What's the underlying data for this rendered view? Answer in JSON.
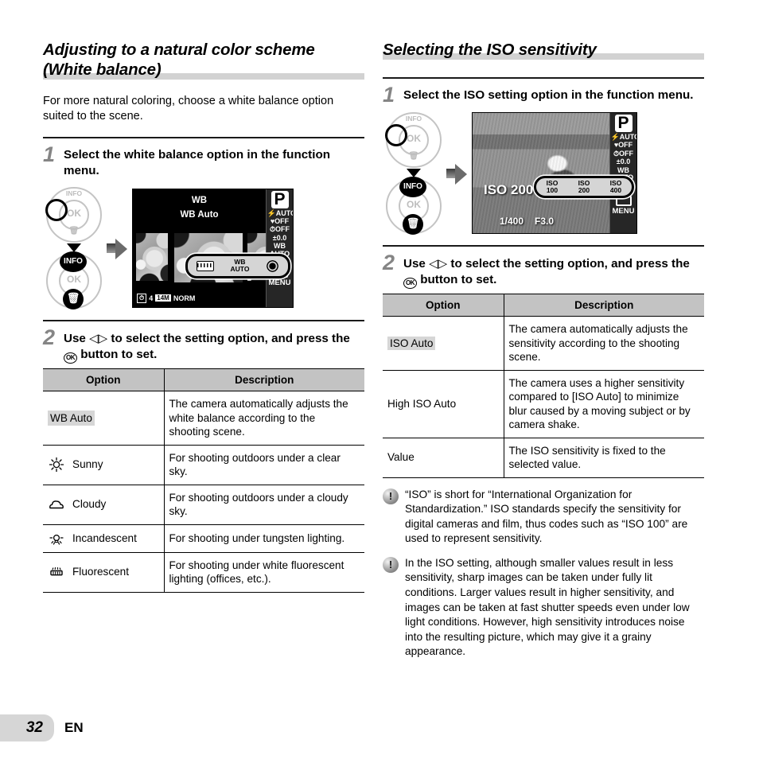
{
  "page": {
    "number": "32",
    "language": "EN"
  },
  "left_column": {
    "heading": "Adjusting to a natural color scheme (White balance)",
    "intro": "For more natural coloring, choose a white balance option suited to the scene.",
    "step1": {
      "number": "1",
      "text_before": "Select the white balance option in the function menu."
    },
    "step2": {
      "number": "2",
      "part1": "Use",
      "arrows": "◁▷",
      "part2": "to select the setting option, and press the",
      "ok_glyph": "OK",
      "part3": "button to set."
    },
    "illustration": {
      "dial_labels": {
        "info": "INFO",
        "ok": "OK",
        "trash": "Ὕ1"
      },
      "dial_top": {
        "info": "INFO",
        "ok": "OK"
      },
      "dial_bottom": {
        "info": "INFO",
        "ok": "OK"
      },
      "lcd": {
        "title": "WB",
        "subtitle": "WB Auto",
        "mode": "P",
        "menu_items": [
          "AUTO",
          "OFF",
          "OFF",
          "±0.0",
          "WB AUTO",
          "AUTO"
        ],
        "menu_label": "MENU",
        "selection_bar": {
          "label_line1": "WB",
          "label_line2": "AUTO"
        },
        "status": {
          "icon": "self-timer",
          "frames": "4",
          "size": "14M",
          "quality": "NORM"
        }
      }
    },
    "table": {
      "headers": [
        "Option",
        "Description"
      ],
      "rows": [
        {
          "icon": "none",
          "option": "WB Auto",
          "highlight": true,
          "description": "The camera automatically adjusts the white balance according to the shooting scene."
        },
        {
          "icon": "sun-icon",
          "option": "Sunny",
          "highlight": false,
          "description": "For shooting outdoors under a clear sky."
        },
        {
          "icon": "cloud-icon",
          "option": "Cloudy",
          "highlight": false,
          "description": "For shooting outdoors under a cloudy sky."
        },
        {
          "icon": "bulb-icon",
          "option": "Incandescent",
          "highlight": false,
          "description": "For shooting under tungsten lighting."
        },
        {
          "icon": "fluorescent-icon",
          "option": "Fluorescent",
          "highlight": false,
          "description": "For shooting under white fluorescent lighting (offices, etc.)."
        }
      ]
    }
  },
  "right_column": {
    "heading": "Selecting the ISO sensitivity",
    "step1": {
      "number": "1",
      "text_before": "Select the ISO setting option in the function menu."
    },
    "step2": {
      "number": "2",
      "part1": "Use",
      "arrows": "◁▷",
      "part2": "to select the setting option, and press the",
      "ok_glyph": "OK",
      "part3": "button to set."
    },
    "illustration": {
      "lcd": {
        "mode": "P",
        "menu_items": [
          "AUTO",
          "OFF",
          "OFF",
          "±0.0",
          "WB AUTO"
        ],
        "menu_label": "MENU",
        "iso_reading": "ISO 200",
        "shutter": "1/400",
        "aperture": "F3.0",
        "selection_bar": [
          {
            "line1": "ISO",
            "line2": "100"
          },
          {
            "line1": "ISO",
            "line2": "200"
          },
          {
            "line1": "ISO",
            "line2": "400"
          }
        ]
      }
    },
    "table": {
      "headers": [
        "Option",
        "Description"
      ],
      "rows": [
        {
          "option": "ISO Auto",
          "highlight": true,
          "description": "The camera automatically adjusts the sensitivity according to the shooting scene."
        },
        {
          "option": "High ISO Auto",
          "highlight": false,
          "description": "The camera uses a higher sensitivity compared to [ISO Auto] to minimize blur caused by a moving subject or by camera shake."
        },
        {
          "option": "Value",
          "highlight": false,
          "description": "The ISO sensitivity is fixed to the selected value."
        }
      ]
    },
    "notes": [
      {
        "marker": "!",
        "text": "“ISO” is short for “International Organization for Standardization.” ISO standards specify the sensitivity for digital cameras and film, thus codes such as “ISO 100” are used to represent sensitivity."
      },
      {
        "marker": "!",
        "text": "In the ISO setting, although smaller values result in less sensitivity, sharp images can be taken under fully lit conditions. Larger values result in higher sensitivity, and images can be taken at fast shutter speeds even under low light conditions. However, high sensitivity introduces noise into the resulting picture, which may give it a grainy appearance."
      }
    ]
  },
  "colors": {
    "heading_band": "#d2d2d2",
    "table_header": "#c3c3c3",
    "highlight": "#d6d6d6",
    "page_tab": "#d6d6d6",
    "step_number": "#858585"
  }
}
